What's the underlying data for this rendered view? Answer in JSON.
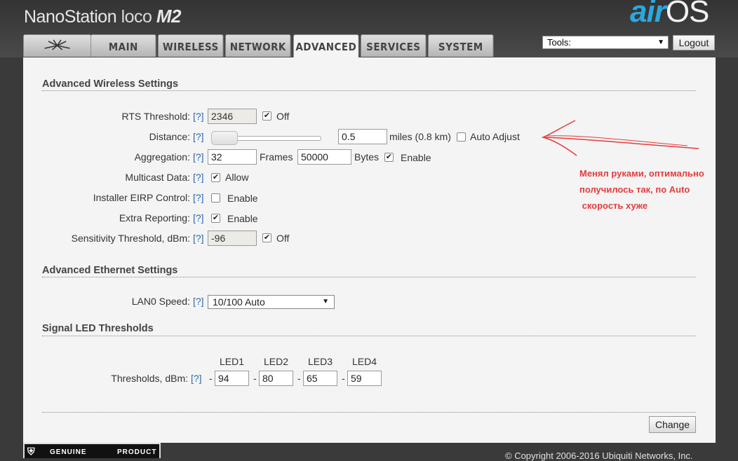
{
  "header": {
    "brand_main": "NanoStation",
    "brand_loco": "loco",
    "brand_m2": "M2",
    "os_air": "air",
    "os_name": "OS"
  },
  "tabs": [
    {
      "label": "MAIN"
    },
    {
      "label": "WIRELESS"
    },
    {
      "label": "NETWORK"
    },
    {
      "label": "ADVANCED",
      "active": true
    },
    {
      "label": "SERVICES"
    },
    {
      "label": "SYSTEM"
    }
  ],
  "tools": {
    "label": "Tools:"
  },
  "logout_label": "Logout",
  "help_text": "[?]",
  "wireless": {
    "title": "Advanced Wireless Settings",
    "rts": {
      "label": "RTS Threshold:",
      "value": "2346",
      "off_label": "Off",
      "off_checked": true
    },
    "distance": {
      "label": "Distance:",
      "value": "0.5",
      "units": "miles (0.8 km)",
      "auto_label": "Auto Adjust",
      "auto_checked": false,
      "slider_fraction": 0.0
    },
    "aggregation": {
      "label": "Aggregation:",
      "frames_value": "32",
      "frames_label": "Frames",
      "bytes_value": "50000",
      "bytes_label": "Bytes",
      "enable_label": "Enable",
      "enable_checked": true
    },
    "multicast": {
      "label": "Multicast Data:",
      "allow_label": "Allow",
      "checked": true
    },
    "eirp": {
      "label": "Installer EIRP Control:",
      "enable_label": "Enable",
      "checked": false
    },
    "reporting": {
      "label": "Extra Reporting:",
      "enable_label": "Enable",
      "checked": true
    },
    "sensitivity": {
      "label": "Sensitivity Threshold, dBm:",
      "value": "-96",
      "off_label": "Off",
      "off_checked": true
    }
  },
  "ethernet": {
    "title": "Advanced Ethernet Settings",
    "lan0": {
      "label": "LAN0 Speed:",
      "value": "10/100 Auto"
    }
  },
  "led": {
    "title": "Signal LED Thresholds",
    "label": "Thresholds, dBm:",
    "dash": "-",
    "leds": [
      {
        "name": "LED1",
        "value": "94"
      },
      {
        "name": "LED2",
        "value": "80"
      },
      {
        "name": "LED3",
        "value": "65"
      },
      {
        "name": "LED4",
        "value": "59"
      }
    ]
  },
  "change_label": "Change",
  "annotation": {
    "line1": "Менял руками, оптимально",
    "line2": "получилось так, по Auto",
    "line3": " скорость хуже"
  },
  "footer": {
    "copyright": "© Copyright 2006-2016 Ubiquiti Networks, Inc.",
    "genuine_text": "GENUINE",
    "product_text": "PRODUCT"
  },
  "colors": {
    "accent_blue": "#2aa8e0",
    "help_link": "#2b6ab0",
    "annotation_red": "#e53c3c"
  }
}
